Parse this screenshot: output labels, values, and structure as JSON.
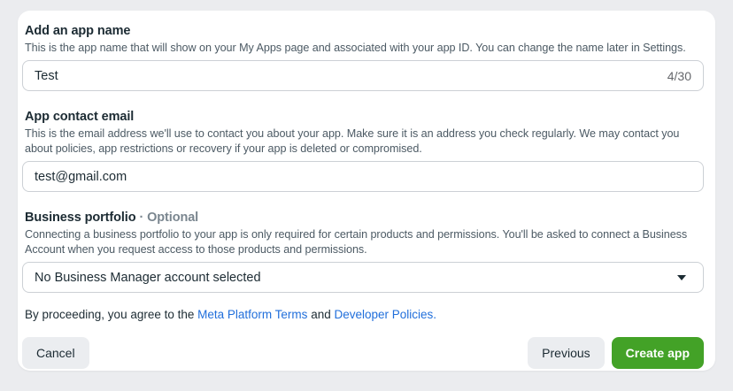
{
  "dialog": {
    "app_name": {
      "label": "Add an app name",
      "description": "This is the app name that will show on your My Apps page and associated with your app ID. You can change the name later in Settings.",
      "value": "Test",
      "counter": "4/30"
    },
    "contact_email": {
      "label": "App contact email",
      "description": "This is the email address we'll use to contact you about your app. Make sure it is an address you check regularly. We may contact you about policies, app restrictions or recovery if your app is deleted or compromised.",
      "value": "test@gmail.com"
    },
    "business_portfolio": {
      "label": "Business portfolio",
      "separator": "·",
      "optional_tag": "Optional",
      "description": "Connecting a business portfolio to your app is only required for certain products and permissions. You'll be asked to connect a Business Account when you request access to those products and permissions.",
      "selected_value": "No Business Manager account selected",
      "caret_icon": "caret-down"
    },
    "terms": {
      "prefix": "By proceeding, you agree to the ",
      "link_platform_terms": "Meta Platform Terms",
      "conjunction": " and ",
      "link_developer_policies": "Developer Policies."
    },
    "actions": {
      "cancel_label": "Cancel",
      "previous_label": "Previous",
      "create_label": "Create app"
    },
    "colors": {
      "primary_button_green": "#43a227",
      "link_blue": "#216fdb",
      "page_background": "#ebecef"
    }
  }
}
